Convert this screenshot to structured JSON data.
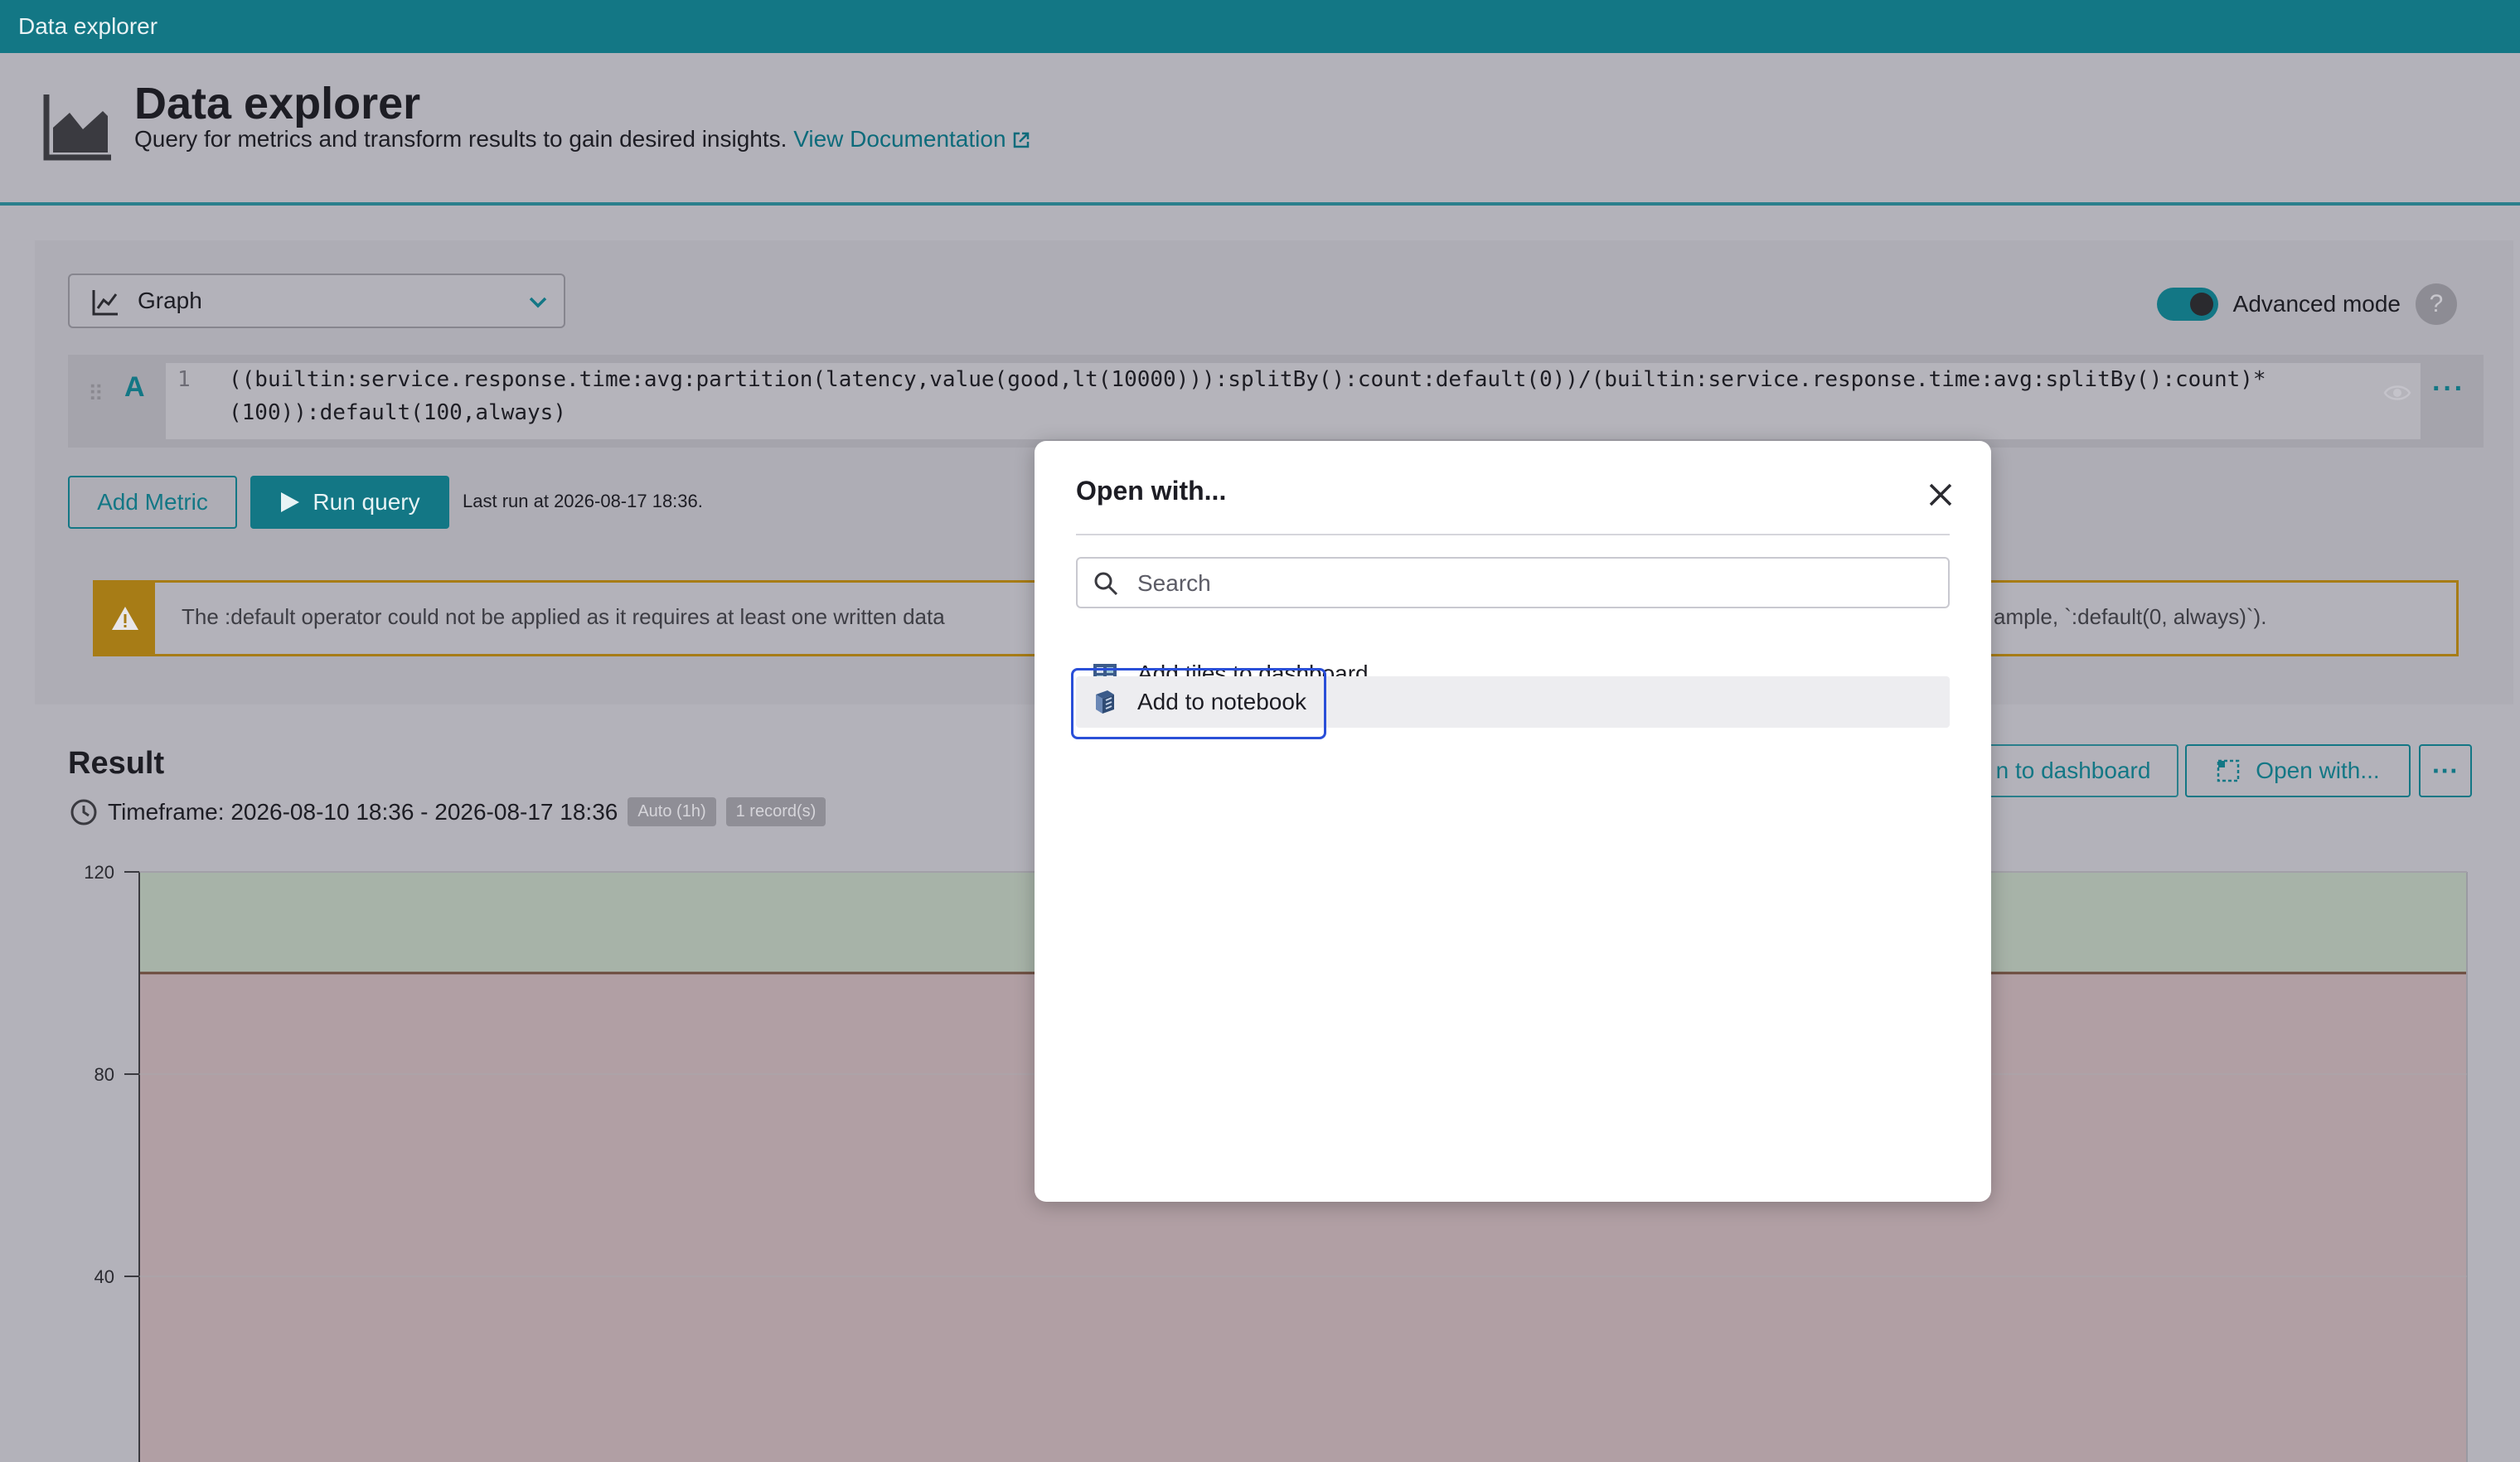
{
  "window": {
    "title": "Data explorer"
  },
  "header": {
    "title": "Data explorer",
    "subtitle": "Query for metrics and transform results to gain desired insights.",
    "doc_link": "View Documentation"
  },
  "controls": {
    "visualization": "Graph",
    "advanced_mode_label": "Advanced mode",
    "advanced_mode_on": true,
    "help": "?"
  },
  "query": {
    "letter": "A",
    "line_number": "1",
    "line1_text": "((builtin:service.response.time:avg:partition(latency,value(good,lt(10000))):splitBy():count:default(0))/(builtin:service.response.time:avg:splitBy():count)*",
    "line2_text": "(100)):default(100,always)"
  },
  "actions": {
    "add_metric": "Add Metric",
    "run_query": "Run query",
    "last_run": "Last run at 2026-08-17 18:36."
  },
  "warning": {
    "text_left": "The :default operator could not be applied as it requires at least one written data",
    "text_right": "ample, `:default(0, always)`)."
  },
  "result": {
    "title": "Result",
    "timeframe": "Timeframe: 2026-08-10 18:36 - 2026-08-17 18:36",
    "auto_tag": "Auto (1h)",
    "records_tag": "1 record(s)",
    "pin_button": "n to dashboard",
    "open_with_button": "Open with..."
  },
  "chart_data": {
    "type": "area",
    "ylim": [
      20,
      120
    ],
    "y_ticks": [
      "120",
      "80",
      "40"
    ],
    "threshold_upper": 100,
    "colors": {
      "upper_band": "#a7b3a8",
      "lower_band": "#b19fa4",
      "line": "#6b4a3c"
    }
  },
  "modal": {
    "title": "Open with...",
    "search_placeholder": "Search",
    "options": [
      {
        "label": "Add tiles to dashboard",
        "icon": "dashboard-tiles-icon"
      },
      {
        "label": "Add to notebook",
        "icon": "notebook-icon"
      }
    ]
  }
}
